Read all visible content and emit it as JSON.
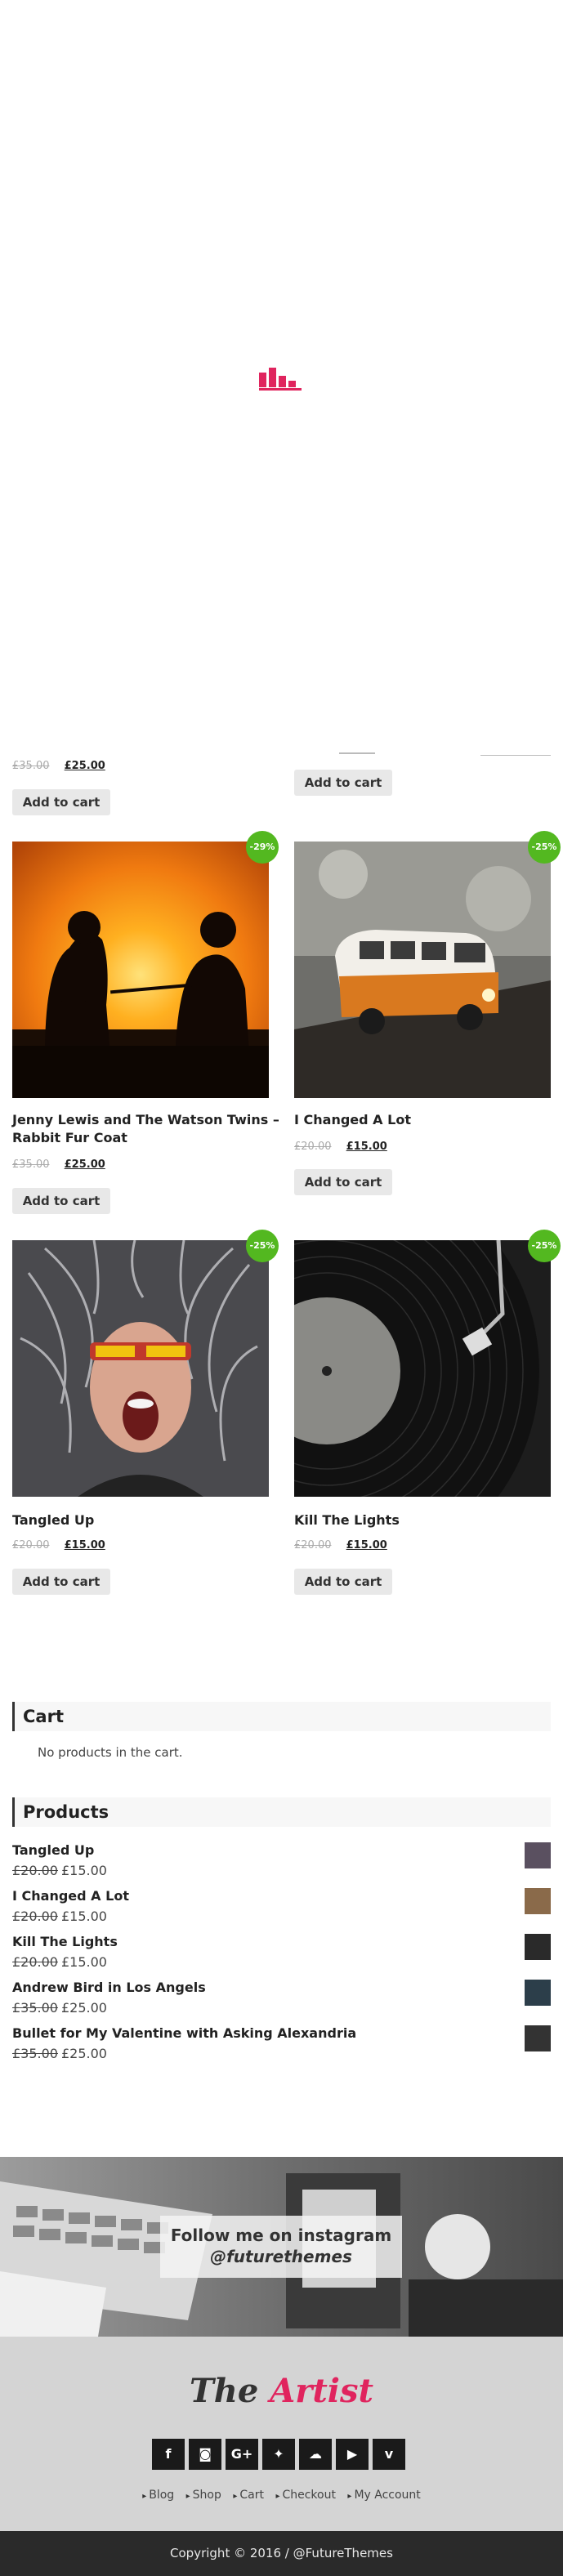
{
  "first_row": {
    "left": {
      "old_price": "£35.00",
      "new_price": "£25.00",
      "button": "Add to cart"
    },
    "right": {
      "button": "Add to cart"
    }
  },
  "products": [
    {
      "title_line1": "Jenny Lewis and The Watson Twins –",
      "title_line2": "Rabbit Fur Coat",
      "old_price": "£35.00",
      "new_price": "£25.00",
      "badge": "-29%",
      "button": "Add to cart",
      "image": "sunset-guitar-silhouettes"
    },
    {
      "title_line1": "I Changed A Lot",
      "title_line2": "",
      "old_price": "£20.00",
      "new_price": "£15.00",
      "badge": "-25%",
      "button": "Add to cart",
      "image": "toy-van"
    },
    {
      "title_line1": "Tangled Up",
      "title_line2": "",
      "old_price": "£20.00",
      "new_price": "£15.00",
      "badge": "-25%",
      "button": "Add to cart",
      "image": "screaming-man"
    },
    {
      "title_line1": "Kill The Lights",
      "title_line2": "",
      "old_price": "£20.00",
      "new_price": "£15.00",
      "badge": "-25%",
      "button": "Add to cart",
      "image": "vinyl-record"
    }
  ],
  "cart_widget": {
    "title": "Cart",
    "empty_text": "No products in the cart."
  },
  "products_widget": {
    "title": "Products",
    "items": [
      {
        "name": "Tangled Up",
        "old": "£20.00",
        "new": "£15.00"
      },
      {
        "name": "I Changed A Lot",
        "old": "£20.00",
        "new": "£15.00"
      },
      {
        "name": "Kill The Lights",
        "old": "£20.00",
        "new": "£15.00"
      },
      {
        "name": "Andrew Bird in Los Angels",
        "old": "£35.00",
        "new": "£25.00"
      },
      {
        "name": "Bullet for My Valentine with Asking Alexandria",
        "old": "£35.00",
        "new": "£25.00"
      }
    ]
  },
  "instagram": {
    "line1": "Follow me on instagram",
    "line2": "@futurethemes"
  },
  "footer": {
    "logo_part1": "The",
    "logo_part2": "Artist",
    "socials": [
      {
        "icon": "facebook-icon",
        "glyph": "f"
      },
      {
        "icon": "instagram-icon",
        "glyph": "◙"
      },
      {
        "icon": "google-plus-icon",
        "glyph": "G+"
      },
      {
        "icon": "twitter-icon",
        "glyph": "✦"
      },
      {
        "icon": "soundcloud-icon",
        "glyph": "☁"
      },
      {
        "icon": "youtube-icon",
        "glyph": "▶"
      },
      {
        "icon": "vimeo-icon",
        "glyph": "v"
      }
    ],
    "nav": [
      "Blog",
      "Shop",
      "Cart",
      "Checkout",
      "My Account"
    ],
    "copyright": "Copyright © 2016 / @FutureThemes"
  },
  "colors": {
    "accent": "#e0245e",
    "badge": "#53b820"
  }
}
